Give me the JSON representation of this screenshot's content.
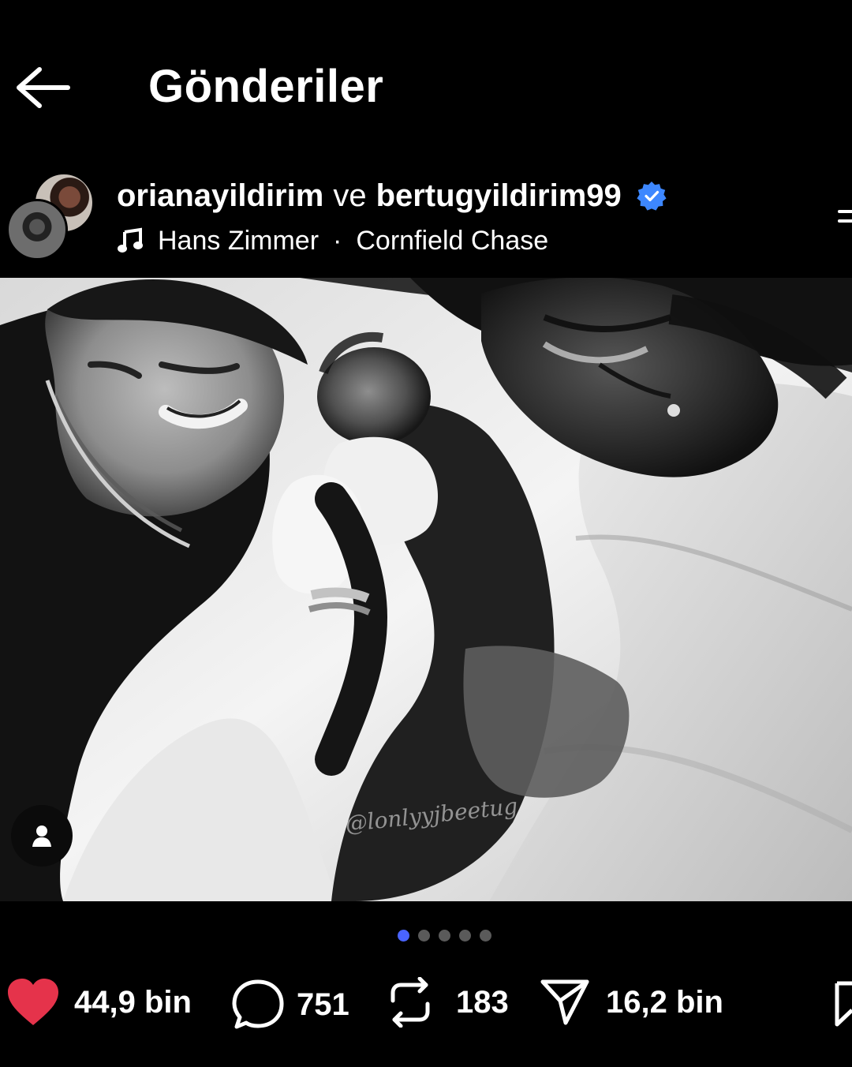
{
  "header": {
    "title": "Gönderiler",
    "back_icon": "arrow-left-icon"
  },
  "post": {
    "users": [
      "orianayildirim",
      "bertugyildirim99"
    ],
    "connector": "ve",
    "verified": true,
    "music": {
      "artist": "Hans Zimmer",
      "separator": "·",
      "track": "Cornfield Chase"
    },
    "watermark": "@lonlyyjbeetug",
    "carousel": {
      "active_index": 0,
      "count": 5
    }
  },
  "actions": {
    "likes": "44,9 bin",
    "comments": "751",
    "reposts": "183",
    "shares": "16,2 bin"
  },
  "colors": {
    "accent": "#4a64ff",
    "like": "#e5334b",
    "verified": "#3d87ff"
  }
}
